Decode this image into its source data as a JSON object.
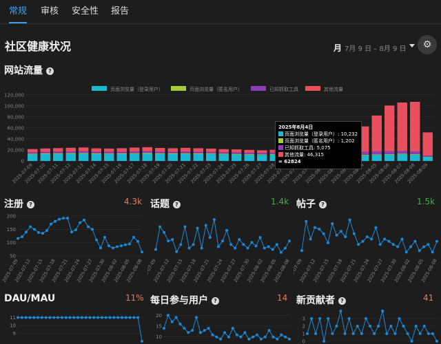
{
  "tabs": [
    {
      "label": "常规",
      "active": true
    },
    {
      "label": "审核",
      "active": false
    },
    {
      "label": "安全性",
      "active": false
    },
    {
      "label": "报告",
      "active": false
    }
  ],
  "page_title": "社区健康状况",
  "date_range": {
    "period": "月",
    "text": "7月 9 日 – 8月 9 日"
  },
  "settings_icon": "gear-icon",
  "colors": {
    "accent": "#3fa0e8",
    "logged_in": "#1cb8d1",
    "anonymous": "#a6ce39",
    "crawlers": "#8b3fb5",
    "other": "#e8505f",
    "line": "#1a8ad8",
    "up": "#3cb043",
    "down": "#e67c5c"
  },
  "traffic": {
    "title": "网站流量",
    "chart_data": {
      "type": "bar",
      "stacked": true,
      "categories": [
        "2025-07-09",
        "2025-07-10",
        "2025-07-11",
        "2025-07-12",
        "2025-07-13",
        "2025-07-14",
        "2025-07-15",
        "2025-07-16",
        "2025-07-17",
        "2025-07-18",
        "2025-07-19",
        "2025-07-20",
        "2025-07-21",
        "2025-07-22",
        "2025-07-23",
        "2025-07-24",
        "2025-07-25",
        "2025-07-26",
        "2025-07-27",
        "2025-07-28",
        "2025-07-29",
        "2025-07-30",
        "2025-07-31",
        "2025-08-01",
        "2025-08-02",
        "2025-08-03",
        "2025-08-04",
        "2025-08-05",
        "2025-08-06",
        "2025-08-07",
        "2025-08-08",
        "2025-08-09"
      ],
      "series": [
        {
          "name": "页面浏览量（登录用户）",
          "values": [
            12000,
            12500,
            12800,
            13000,
            13200,
            12600,
            12400,
            12500,
            12900,
            13100,
            12700,
            12500,
            12800,
            12600,
            12400,
            12000,
            11800,
            11300,
            11000,
            11500,
            11400,
            11000,
            10800,
            10500,
            10400,
            10300,
            10232,
            11000,
            11500,
            12000,
            11500,
            7000
          ]
        },
        {
          "name": "页面浏览量（匿名用户）",
          "values": [
            1200,
            1200,
            1300,
            1300,
            1300,
            1200,
            1200,
            1200,
            1300,
            1300,
            1200,
            1200,
            1200,
            1200,
            1200,
            1100,
            1100,
            1100,
            1000,
            1100,
            1100,
            1000,
            1000,
            1000,
            1000,
            1000,
            1202,
            1100,
            1100,
            1200,
            1200,
            800
          ]
        },
        {
          "name": "已知抓取工具",
          "values": [
            3000,
            3100,
            3100,
            3200,
            3300,
            3000,
            3000,
            3100,
            3200,
            3300,
            3100,
            3000,
            3100,
            3000,
            2900,
            2800,
            2800,
            2700,
            2600,
            2700,
            2700,
            2600,
            2500,
            2600,
            2800,
            4000,
            5075,
            5500,
            5200,
            5000,
            4800,
            2200
          ]
        },
        {
          "name": "其他流量",
          "values": [
            5500,
            6000,
            6200,
            6500,
            6800,
            6200,
            6000,
            6400,
            7000,
            7400,
            6700,
            6400,
            6800,
            6400,
            6000,
            5600,
            5400,
            5000,
            4700,
            5000,
            4900,
            4700,
            4500,
            5300,
            6500,
            22000,
            46315,
            65000,
            83000,
            88000,
            90000,
            42000
          ]
        }
      ],
      "ylim": [
        0,
        120000
      ],
      "yticks": [
        "0",
        "20,000",
        "40,000",
        "60,000",
        "80,000",
        "100,000",
        "120,000"
      ],
      "legend": "top"
    },
    "tooltip": {
      "date": "2025年8月4日",
      "rows": [
        "页面浏览量（登录用户）: 10,232",
        "页面浏览量（匿名用户）: 1,202",
        "已知抓取工具: 5,075",
        "其他流量: 46,315"
      ],
      "total": "= 62824"
    }
  },
  "signups": {
    "title": "注册",
    "value": "4.3k",
    "trend": "down",
    "chart_data": {
      "type": "line",
      "x": [
        "2025-07-09",
        "2025-07-12",
        "2025-07-15",
        "2025-07-18",
        "2025-07-21",
        "2025-07-24",
        "2025-07-27",
        "2025-07-30",
        "2025-08-02",
        "2025-08-05",
        "2025-08-08"
      ],
      "values": [
        116,
        122,
        140,
        160,
        150,
        138,
        135,
        145,
        170,
        180,
        188,
        192,
        192,
        140,
        148,
        175,
        185,
        160,
        150,
        110,
        80,
        120,
        88,
        80,
        85,
        88,
        92,
        95,
        120,
        105,
        65
      ],
      "ylim": [
        50,
        200
      ],
      "yticks": [
        "50",
        "100",
        "150",
        "200"
      ]
    }
  },
  "topics": {
    "title": "话题",
    "value": "1.4k",
    "trend": "up",
    "chart_data": {
      "type": "line",
      "x": [
        "2025-07-09",
        "2025-07-12",
        "2025-07-15",
        "2025-07-18",
        "2025-07-21",
        "2025-07-24",
        "2025-07-27",
        "2025-07-30",
        "2025-08-02",
        "2025-08-05",
        "2025-08-08"
      ],
      "values": [
        28,
        60,
        52,
        40,
        42,
        25,
        35,
        60,
        30,
        35,
        58,
        30,
        62,
        45,
        70,
        32,
        40,
        55,
        35,
        30,
        42,
        35,
        30,
        38,
        33,
        45,
        30,
        32,
        28,
        35,
        24,
        30,
        40
      ]
    }
  },
  "posts": {
    "title": "帖子",
    "value": "1.5k",
    "trend": "up",
    "chart_data": {
      "type": "line",
      "x": [
        "2025-07-09",
        "2025-07-12",
        "2025-07-15",
        "2025-07-18",
        "2025-07-21",
        "2025-07-24",
        "2025-07-27",
        "2025-07-30",
        "2025-08-02",
        "2025-08-05",
        "2025-08-08"
      ],
      "values": [
        30,
        68,
        45,
        60,
        58,
        52,
        40,
        65,
        50,
        55,
        48,
        70,
        52,
        38,
        42,
        48,
        45,
        60,
        38,
        45,
        42,
        38,
        35,
        45,
        28,
        35,
        42,
        30,
        35,
        38,
        28,
        42
      ]
    }
  },
  "dau": {
    "title": "DAU/MAU",
    "value": "11%",
    "trend": "down",
    "chart_data": {
      "type": "line",
      "values": [
        11,
        11,
        11,
        11,
        11,
        11,
        11,
        11,
        11,
        11,
        11,
        11,
        11,
        11,
        11,
        11,
        11,
        11,
        11,
        11,
        11,
        11,
        11,
        11,
        11,
        11,
        11,
        11,
        11,
        11,
        11,
        8
      ],
      "ylim": [
        8,
        12
      ],
      "yticks": [
        "9",
        "10",
        "11"
      ]
    }
  },
  "daily_engaged": {
    "title": "每日参与用户",
    "value": "14",
    "trend": "down",
    "chart_data": {
      "type": "line",
      "values": [
        14,
        20,
        17,
        19,
        16,
        14,
        12,
        13,
        19,
        12,
        13,
        14,
        11,
        10,
        9,
        12,
        10,
        14,
        11,
        10,
        12,
        9,
        10,
        11,
        9,
        10,
        13,
        10,
        9,
        11,
        10,
        9
      ],
      "ylim": [
        8,
        22
      ],
      "yticks": [
        "10",
        "15",
        "20"
      ]
    }
  },
  "new_contributors": {
    "title": "新贡献者",
    "value": "41",
    "trend": "down",
    "chart_data": {
      "type": "line",
      "values": [
        1,
        3,
        1,
        3,
        0,
        3,
        1,
        2,
        4,
        1,
        3,
        1,
        2,
        1,
        3,
        2,
        1,
        2,
        4,
        1,
        2,
        1,
        3,
        2,
        1,
        0,
        2,
        1,
        2,
        1,
        1,
        0
      ],
      "ylim": [
        0,
        4
      ],
      "yticks": [
        "0",
        "1",
        "2",
        "3"
      ]
    }
  }
}
